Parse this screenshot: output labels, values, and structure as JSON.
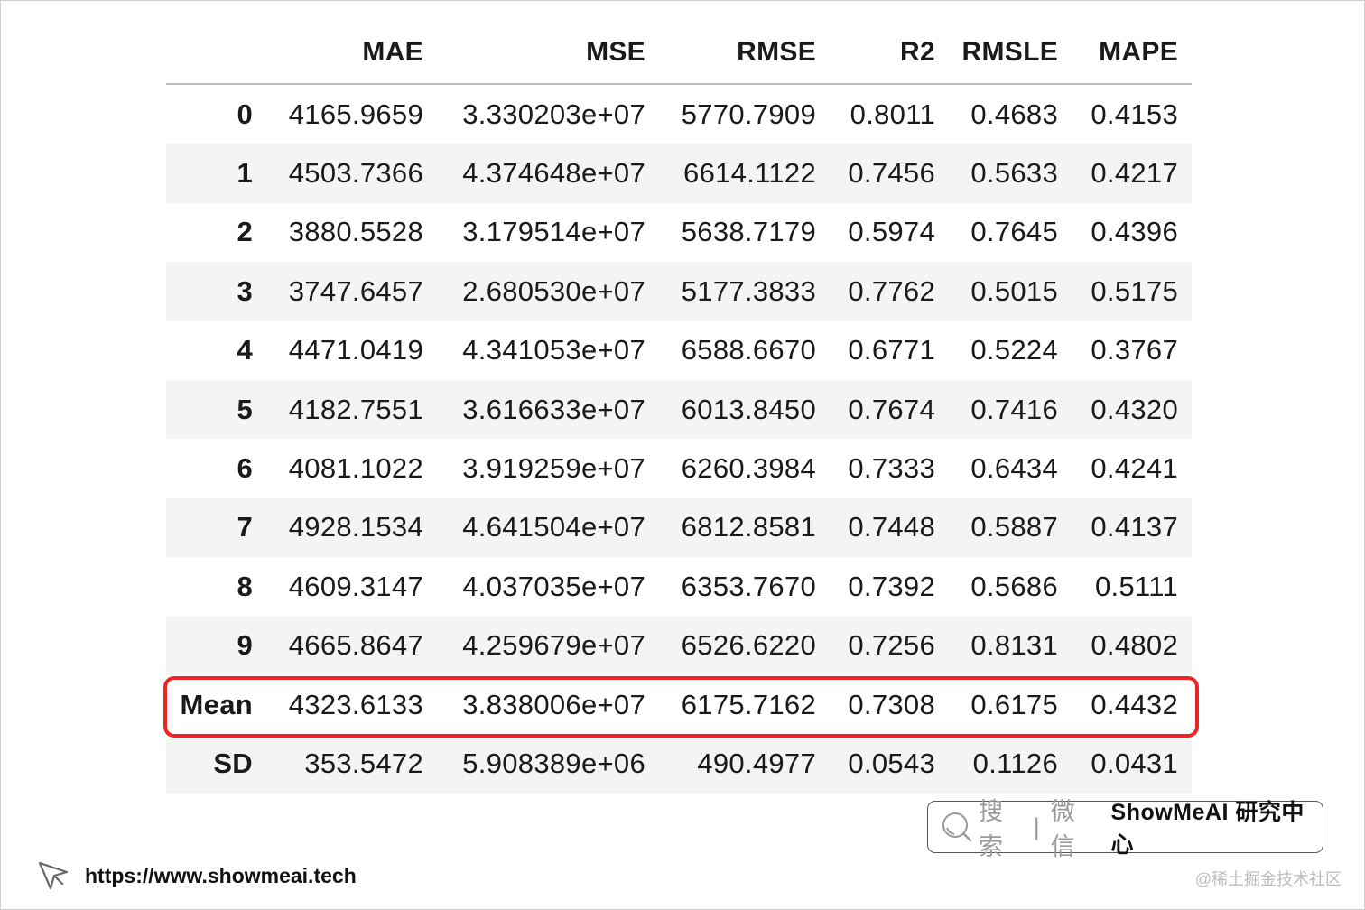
{
  "table": {
    "columns": [
      "MAE",
      "MSE",
      "RMSE",
      "R2",
      "RMSLE",
      "MAPE"
    ],
    "rows": [
      {
        "index": "0",
        "values": [
          "4165.9659",
          "3.330203e+07",
          "5770.7909",
          "0.8011",
          "0.4683",
          "0.4153"
        ]
      },
      {
        "index": "1",
        "values": [
          "4503.7366",
          "4.374648e+07",
          "6614.1122",
          "0.7456",
          "0.5633",
          "0.4217"
        ]
      },
      {
        "index": "2",
        "values": [
          "3880.5528",
          "3.179514e+07",
          "5638.7179",
          "0.5974",
          "0.7645",
          "0.4396"
        ]
      },
      {
        "index": "3",
        "values": [
          "3747.6457",
          "2.680530e+07",
          "5177.3833",
          "0.7762",
          "0.5015",
          "0.5175"
        ]
      },
      {
        "index": "4",
        "values": [
          "4471.0419",
          "4.341053e+07",
          "6588.6670",
          "0.6771",
          "0.5224",
          "0.3767"
        ]
      },
      {
        "index": "5",
        "values": [
          "4182.7551",
          "3.616633e+07",
          "6013.8450",
          "0.7674",
          "0.7416",
          "0.4320"
        ]
      },
      {
        "index": "6",
        "values": [
          "4081.1022",
          "3.919259e+07",
          "6260.3984",
          "0.7333",
          "0.6434",
          "0.4241"
        ]
      },
      {
        "index": "7",
        "values": [
          "4928.1534",
          "4.641504e+07",
          "6812.8581",
          "0.7448",
          "0.5887",
          "0.4137"
        ]
      },
      {
        "index": "8",
        "values": [
          "4609.3147",
          "4.037035e+07",
          "6353.7670",
          "0.7392",
          "0.5686",
          "0.5111"
        ]
      },
      {
        "index": "9",
        "values": [
          "4665.8647",
          "4.259679e+07",
          "6526.6220",
          "0.7256",
          "0.8131",
          "0.4802"
        ]
      },
      {
        "index": "Mean",
        "values": [
          "4323.6133",
          "3.838006e+07",
          "6175.7162",
          "0.7308",
          "0.6175",
          "0.4432"
        ]
      },
      {
        "index": "SD",
        "values": [
          "353.5472",
          "5.908389e+06",
          "490.4977",
          "0.0543",
          "0.1126",
          "0.0431"
        ]
      }
    ],
    "highlighted_row": "Mean",
    "highlight_color": "#ee2424",
    "stripe_color": "#f4f4f4"
  },
  "footer": {
    "search_label": "搜索",
    "separator": "|",
    "wechat_label": "微信",
    "brand": "ShowMeAI 研究中心",
    "url": "https://www.showmeai.tech",
    "credit": "@稀土掘金技术社区"
  }
}
